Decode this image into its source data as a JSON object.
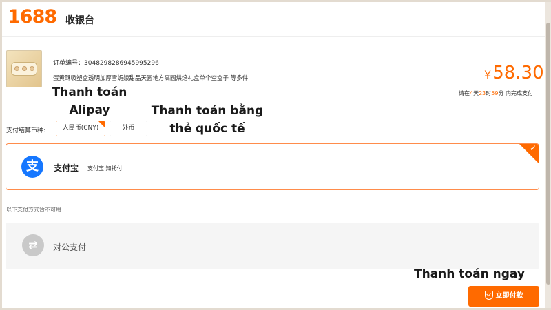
{
  "header": {
    "logo": "1688",
    "title": "收银台"
  },
  "order": {
    "number_label": "订单编号：",
    "number": "3048298286945995296",
    "title": "蛋黄酥吸塑盒透明加厚雪媚娘甜品天圆地方高圆烘焙礼盒单个空盒子 等多件",
    "price_currency": "¥",
    "price": "58.30",
    "deadline": {
      "p1": "请在",
      "days": "4",
      "p2": "天",
      "hours": "23",
      "p3": "时",
      "minutes": "59",
      "p4": "分 内完成支付"
    }
  },
  "overlays": {
    "alipay_line1": "Thanh toán",
    "alipay_line2": "Alipay",
    "intl_line1": "Thanh toán bằng",
    "intl_line2": "thẻ quốc tế",
    "pay_now": "Thanh toán ngay"
  },
  "currency": {
    "label": "支付结算币种:",
    "options": [
      "人民币(CNY)",
      "外币"
    ],
    "selected": "人民币(CNY)"
  },
  "payment_methods": {
    "alipay": {
      "name": "支付宝",
      "sub": "支付宝 知托付",
      "icon": "alipay-icon",
      "selected": true
    },
    "unavailable_note": "以下支付方式暂不可用",
    "corporate": {
      "name": "对公支付",
      "icon": "transfer-icon",
      "enabled": false
    }
  },
  "pay_button": {
    "label": "立即付款",
    "icon": "shield-check-icon"
  },
  "colors": {
    "accent": "#ff6a00",
    "alipay_blue": "#1677ff"
  }
}
